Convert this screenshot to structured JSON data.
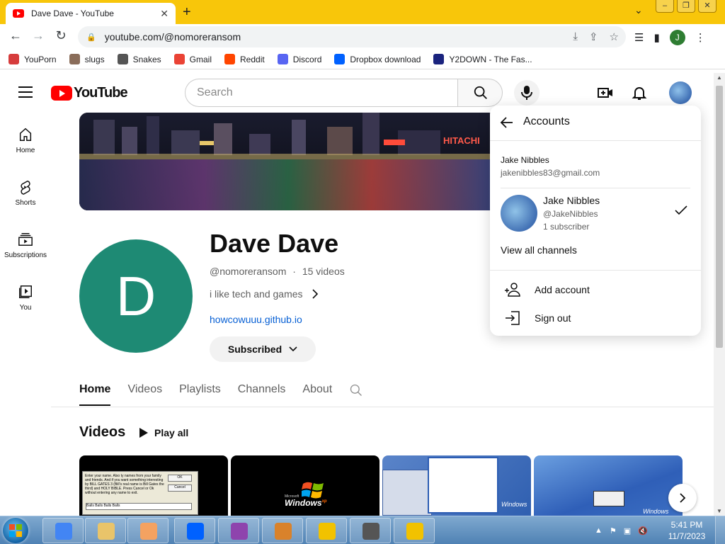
{
  "browser": {
    "tab_title": "Dave Dave - YouTube",
    "url": "youtube.com/@nomoreransom",
    "profile_initial": "J",
    "bookmarks": [
      {
        "label": "YouPorn",
        "color": "#d63c3c"
      },
      {
        "label": "slugs",
        "color": "#8a6d5a"
      },
      {
        "label": "Snakes",
        "color": "#555555"
      },
      {
        "label": "Gmail",
        "color": "#ea4335"
      },
      {
        "label": "Reddit",
        "color": "#ff4500"
      },
      {
        "label": "Discord",
        "color": "#5865f2"
      },
      {
        "label": "Dropbox download",
        "color": "#0061ff"
      },
      {
        "label": "Y2DOWN - The Fas...",
        "color": "#1a237e"
      }
    ]
  },
  "youtube": {
    "logo_text": "YouTube",
    "search_placeholder": "Search",
    "sidebar": [
      {
        "label": "Home",
        "icon": "home-icon"
      },
      {
        "label": "Shorts",
        "icon": "shorts-icon"
      },
      {
        "label": "Subscriptions",
        "icon": "subscriptions-icon"
      },
      {
        "label": "You",
        "icon": "library-icon"
      }
    ],
    "channel": {
      "avatar_letter": "D",
      "name": "Dave Dave",
      "handle": "@nomoreransom",
      "separator": "·",
      "video_count": "15 videos",
      "description": "i like tech and games",
      "link": "howcowuuu.github.io",
      "subscribe_label": "Subscribed",
      "banner_sign": "HITACHI"
    },
    "tabs": [
      "Home",
      "Videos",
      "Playlists",
      "Channels",
      "About"
    ],
    "active_tab": "Home",
    "videos_section": {
      "title": "Videos",
      "play_all": "Play all"
    },
    "thumbnails": [
      {
        "caption": "Enter your name. Also ty names from your family and friends. And if you want something interesting by BILL GATES 3 (Bill's real name is Bill Gates the third) and HOLY BIBLE. Press Cancel or Ok without entering any name to exit.",
        "field_text": "Balls Balls Balls Balls",
        "ok": "OK",
        "cancel": "Cancel"
      },
      {
        "brand": "Microsoft",
        "product": "Windows",
        "superscript": "xp"
      },
      {
        "text": "Windows"
      },
      {
        "text": "Windows"
      }
    ]
  },
  "accounts_popup": {
    "title": "Accounts",
    "user_name": "Jake Nibbles",
    "user_email": "jakenibbles83@gmail.com",
    "channel_name": "Jake Nibbles",
    "channel_handle": "@JakeNibbles",
    "channel_subs": "1 subscriber",
    "view_all": "View all channels",
    "add_account": "Add account",
    "sign_out": "Sign out"
  },
  "taskbar": {
    "time": "5:41 PM",
    "date": "11/7/2023",
    "items": [
      {
        "icon": "chrome-icon",
        "color": "#4285f4"
      },
      {
        "icon": "explorer-icon",
        "color": "#e9c46a"
      },
      {
        "icon": "media-player-icon",
        "color": "#f4a261"
      },
      {
        "icon": "dropbox-icon",
        "color": "#0061ff"
      },
      {
        "icon": "winrar-icon",
        "color": "#8e44ad"
      },
      {
        "icon": "setup-icon",
        "color": "#d9822b"
      },
      {
        "icon": "pencil-app-icon",
        "color": "#f2c200"
      },
      {
        "icon": "program-icon",
        "color": "#555555"
      },
      {
        "icon": "pencil-app-icon",
        "color": "#f2c200"
      }
    ]
  }
}
